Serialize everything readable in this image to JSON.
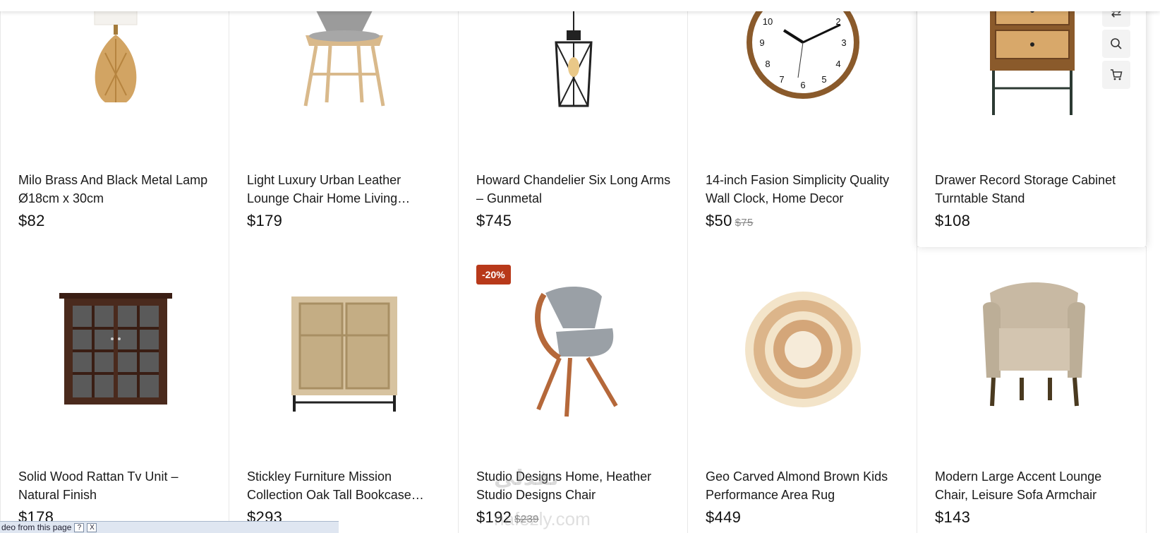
{
  "products_row1": [
    {
      "title": "Milo Brass And Black Metal Lamp Ø18cm x 30cm",
      "price": "$82",
      "old_price": ""
    },
    {
      "title": "Light Luxury Urban Leather Lounge Chair Home Living…",
      "price": "$179",
      "old_price": ""
    },
    {
      "title": "Howard Chandelier Six Long Arms – Gunmetal",
      "price": "$745",
      "old_price": ""
    },
    {
      "title": "14-inch Fasion Simplicity Quality Wall Clock, Home Decor",
      "price": "$50",
      "old_price": "$75"
    },
    {
      "title": "Drawer Record Storage Cabinet Turntable Stand",
      "price": "$108",
      "old_price": ""
    }
  ],
  "products_row2": [
    {
      "title": "Solid Wood Rattan Tv Unit – Natural Finish",
      "price": "$178",
      "old_price": ""
    },
    {
      "title": "Stickley Furniture Mission Collection Oak Tall Bookcase…",
      "price": "$293",
      "old_price": ""
    },
    {
      "title": "Studio Designs Home, Heather Studio Designs Chair",
      "price": "$192",
      "old_price": "$239",
      "badge": "-20%"
    },
    {
      "title": "Geo Carved Almond Brown Kids Performance Area Rug",
      "price": "$449",
      "old_price": ""
    },
    {
      "title": "Modern Large Accent Lounge Chair, Leisure Sofa Armchair",
      "price": "$143",
      "old_price": ""
    }
  ],
  "actions": {
    "compare": "compare-icon",
    "quick_view": "search-icon",
    "add_to_cart": "cart-icon"
  },
  "findbar": {
    "text": "deo from this page",
    "help": "?",
    "close": "X"
  },
  "watermark": {
    "arabic": "نفذلي",
    "latin": "nafezly.com"
  },
  "colors": {
    "badge": "#b8391a",
    "border": "#e8e8e8"
  }
}
